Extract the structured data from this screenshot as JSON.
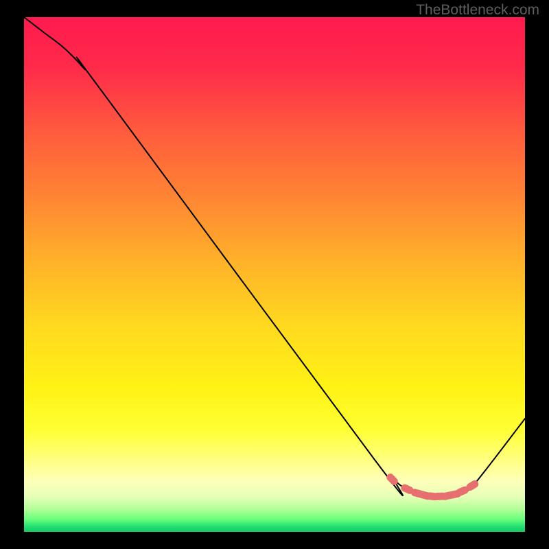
{
  "watermark": "TheBottleneck.com",
  "chart_data": {
    "type": "line",
    "title": "",
    "xlabel": "",
    "ylabel": "",
    "xlim": [
      0,
      100
    ],
    "ylim": [
      0,
      100
    ],
    "grid": false,
    "background_gradient": {
      "stops": [
        {
          "offset": 0.0,
          "color": "#ff1a4e"
        },
        {
          "offset": 0.1,
          "color": "#ff2b4a"
        },
        {
          "offset": 0.22,
          "color": "#ff5a3e"
        },
        {
          "offset": 0.35,
          "color": "#ff8533"
        },
        {
          "offset": 0.48,
          "color": "#ffb329"
        },
        {
          "offset": 0.6,
          "color": "#ffd91f"
        },
        {
          "offset": 0.72,
          "color": "#fff215"
        },
        {
          "offset": 0.8,
          "color": "#ffff33"
        },
        {
          "offset": 0.86,
          "color": "#ffff80"
        },
        {
          "offset": 0.9,
          "color": "#ffffb8"
        },
        {
          "offset": 0.93,
          "color": "#e7ffb8"
        },
        {
          "offset": 0.955,
          "color": "#b6ff9a"
        },
        {
          "offset": 0.975,
          "color": "#6cff7e"
        },
        {
          "offset": 0.99,
          "color": "#1fdf6f"
        },
        {
          "offset": 1.0,
          "color": "#17c765"
        }
      ]
    },
    "series": [
      {
        "name": "curve",
        "stroke": "#000000",
        "stroke_width": 2,
        "x": [
          0,
          4,
          8,
          12,
          16,
          70,
          74,
          76,
          78,
          80,
          82,
          84,
          86,
          88,
          90,
          100
        ],
        "y": [
          100,
          97,
          94,
          90,
          85,
          14,
          10,
          8.5,
          7.6,
          7.1,
          6.9,
          7.0,
          7.4,
          8.2,
          9.4,
          22
        ]
      },
      {
        "name": "markers",
        "type": "scatter",
        "marker_shape": "rounded-rect",
        "marker_color": "#e76f6f",
        "marker_size": 14,
        "x": [
          73.5,
          76.5,
          78.5,
          80.0,
          81.5,
          83.0,
          84.5,
          86.0,
          87.5,
          89.5
        ],
        "y": [
          10.2,
          8.3,
          7.5,
          7.1,
          6.9,
          6.9,
          7.0,
          7.3,
          7.9,
          9.0
        ]
      }
    ]
  }
}
